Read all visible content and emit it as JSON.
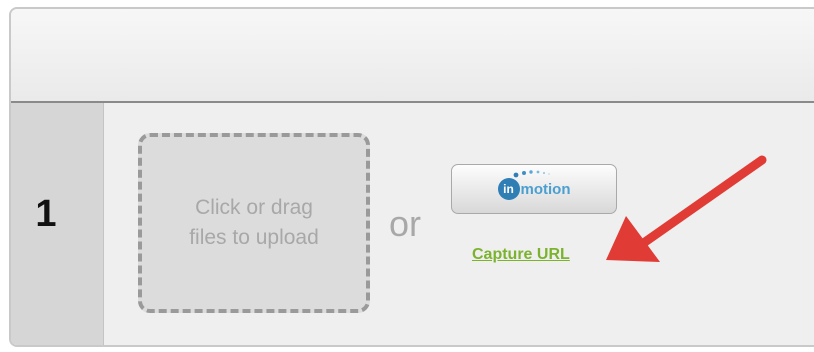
{
  "row": {
    "number": "1"
  },
  "upload": {
    "label": "Click or drag\nfiles to upload"
  },
  "separator": {
    "text": "or"
  },
  "inmotion": {
    "logo_prefix": "in",
    "logo_word": "motion",
    "icon": "inmotion-logo"
  },
  "capture": {
    "link_label": "Capture URL"
  },
  "annotation": {
    "icon": "red-arrow",
    "color": "#e03b35"
  },
  "colors": {
    "link": "#7cb32e",
    "logo_blue": "#2f7fb5",
    "arrow": "#e03b35"
  }
}
